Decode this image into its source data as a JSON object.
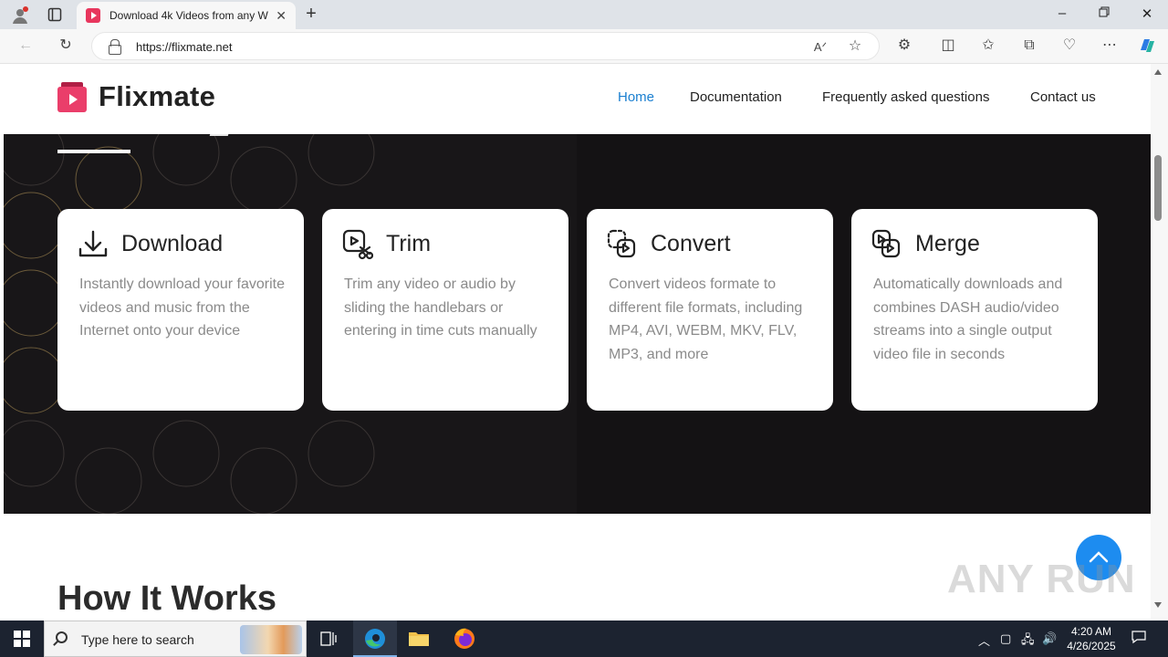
{
  "browser": {
    "tab_title": "Download 4k Videos from any W",
    "url": "https://flixmate.net"
  },
  "site": {
    "brand": "Flixmate",
    "nav": [
      {
        "label": "Home",
        "active": true
      },
      {
        "label": "Documentation",
        "active": false
      },
      {
        "label": "Frequently asked questions",
        "active": false
      },
      {
        "label": "Contact us",
        "active": false
      }
    ],
    "features": [
      {
        "title": "Download",
        "icon": "download-icon",
        "desc": "Instantly download your favorite videos and music from the Internet onto your device"
      },
      {
        "title": "Trim",
        "icon": "trim-icon",
        "desc": "Trim any video or audio by sliding the handlebars or entering in time cuts manually"
      },
      {
        "title": "Convert",
        "icon": "convert-icon",
        "desc": "Convert videos formate to different file formats, including MP4, AVI, WEBM, MKV, FLV, MP3, and more"
      },
      {
        "title": "Merge",
        "icon": "merge-icon",
        "desc": "Automatically downloads and combines DASH audio/video streams into a single output video file in seconds"
      }
    ],
    "section_heading": "How It Works",
    "watermark": "ANY RUN"
  },
  "taskbar": {
    "search_placeholder": "Type here to search",
    "time": "4:20 AM",
    "date": "4/26/2025"
  },
  "colors": {
    "accent": "#1a7fd0",
    "brand": "#ea3e6a",
    "hero_bg": "#141214",
    "scroll_top_button": "#1d8cf0"
  }
}
